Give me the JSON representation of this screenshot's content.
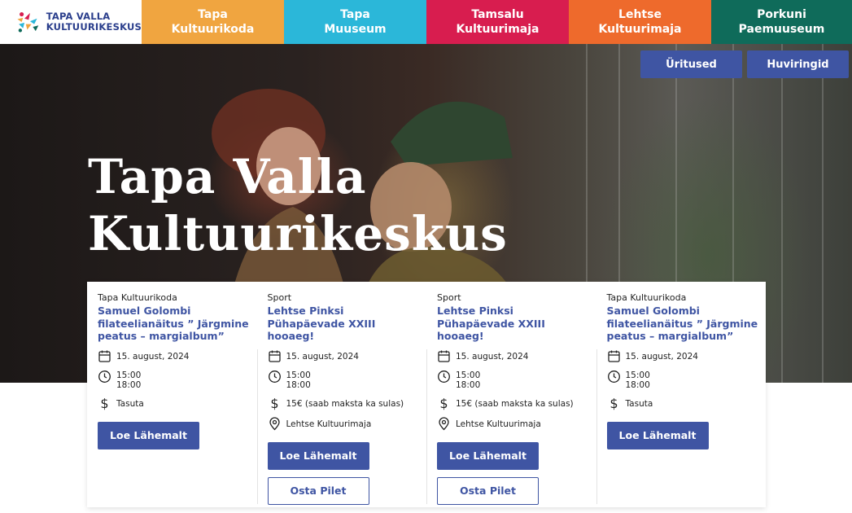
{
  "logo": {
    "line1": "TAPA VALLA",
    "line2": "KULTUURIKESKUS"
  },
  "nav": [
    {
      "label": "Tapa\nKultuurikoda",
      "color": "#f0a540"
    },
    {
      "label": "Tapa\nMuuseum",
      "color": "#2bb7d9"
    },
    {
      "label": "Tamsalu\nKultuurimaja",
      "color": "#d81d4f"
    },
    {
      "label": "Lehtse\nKultuurimaja",
      "color": "#ee6a2c"
    },
    {
      "label": "Porkuni\nPaemuuseum",
      "color": "#0f6b5a"
    }
  ],
  "hero": {
    "title": "Tapa Valla\nKultuurikeskus",
    "buttons": [
      "Üritused",
      "Huviringid"
    ]
  },
  "events": [
    {
      "category": "Tapa Kultuurikoda",
      "title": "Samuel Golombi filateelianäitus ” Järgmine peatus – margialbum”",
      "date": "15. august, 2024",
      "time": "15:00\n18:00",
      "price": "Tasuta",
      "location": "",
      "more_label": "Loe Lähemalt",
      "ticket_label": ""
    },
    {
      "category": "Sport",
      "title": "Lehtse Pinksi Pühapäevade XXIII hooaeg!",
      "date": "15. august, 2024",
      "time": "15:00\n18:00",
      "price": "15€ (saab maksta ka sulas)",
      "location": "Lehtse Kultuurimaja",
      "more_label": "Loe Lähemalt",
      "ticket_label": "Osta Pilet"
    },
    {
      "category": "Sport",
      "title": "Lehtse Pinksi Pühapäevade XXIII hooaeg!",
      "date": "15. august, 2024",
      "time": "15:00\n18:00",
      "price": "15€ (saab maksta ka sulas)",
      "location": "Lehtse Kultuurimaja",
      "more_label": "Loe Lähemalt",
      "ticket_label": "Osta Pilet"
    },
    {
      "category": "Tapa Kultuurikoda",
      "title": "Samuel Golombi filateelianäitus ” Järgmine peatus – margialbum”",
      "date": "15. august, 2024",
      "time": "15:00\n18:00",
      "price": "Tasuta",
      "location": "",
      "more_label": "Loe Lähemalt",
      "ticket_label": ""
    }
  ],
  "colors": {
    "accent": "#3f55a3"
  },
  "icons": [
    "calendar-icon",
    "clock-icon",
    "dollar-icon",
    "location-pin-icon"
  ]
}
